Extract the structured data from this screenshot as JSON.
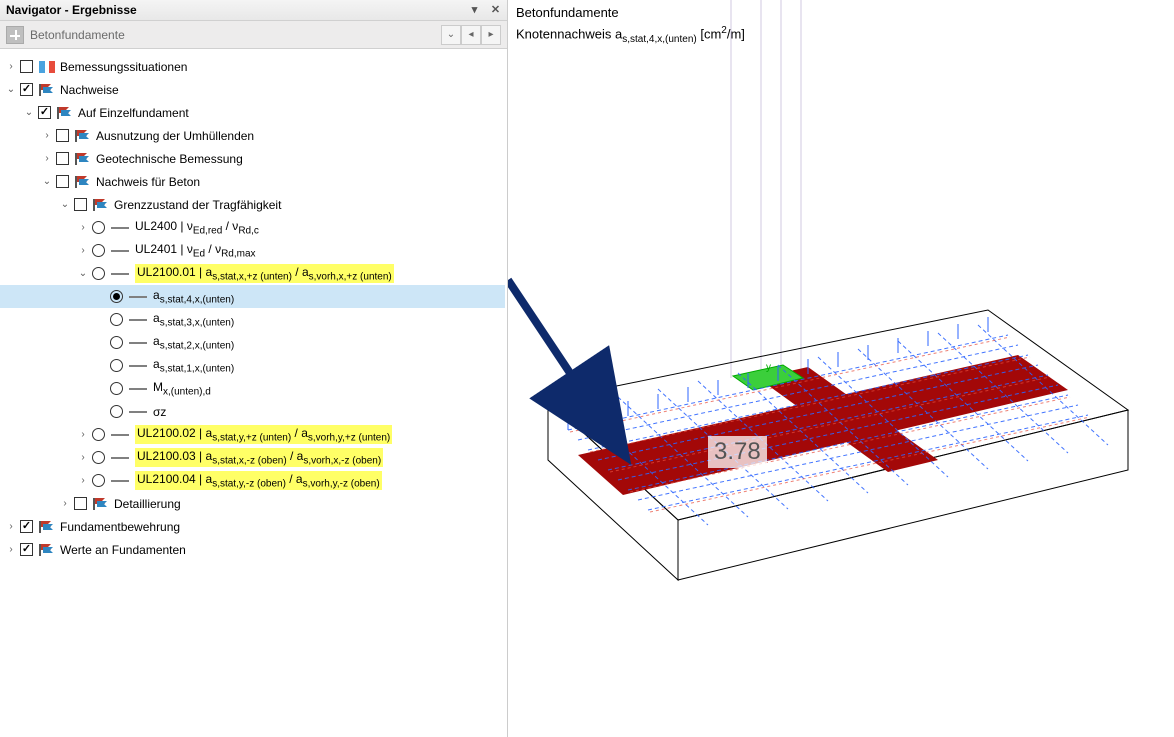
{
  "panel": {
    "title": "Navigator - Ergebnisse",
    "toolbar_label": "Betonfundamente"
  },
  "tree": {
    "r0": "Bemessungssituationen",
    "r1": "Nachweise",
    "r2": "Auf Einzelfundament",
    "r3": "Ausnutzung der Umhüllenden",
    "r4": "Geotechnische Bemessung",
    "r5": "Nachweis für Beton",
    "r6": "Grenzzustand der Tragfähigkeit",
    "r7_a": "UL2400 | ν",
    "r7_b": "Ed,red",
    "r7_c": " / ν",
    "r7_d": "Rd,c",
    "r8_a": "UL2401 | ν",
    "r8_b": "Ed",
    "r8_c": " / ν",
    "r8_d": "Rd,max",
    "r9_a": "UL2100.01 | a",
    "r9_b": "s,stat,x,+z (unten)",
    "r9_c": " / a",
    "r9_d": "s,vorh,x,+z (unten)",
    "r10_a": "a",
    "r10_b": "s,stat,4,x,(unten)",
    "r11_a": "a",
    "r11_b": "s,stat,3,x,(unten)",
    "r12_a": "a",
    "r12_b": "s,stat,2,x,(unten)",
    "r13_a": "a",
    "r13_b": "s,stat,1,x,(unten)",
    "r14_a": "M",
    "r14_b": "x,(unten),d",
    "r15": "σz",
    "r16_a": "UL2100.02 | a",
    "r16_b": "s,stat,y,+z (unten)",
    "r16_c": " / a",
    "r16_d": "s,vorh,y,+z (unten)",
    "r17_a": "UL2100.03 | a",
    "r17_b": "s,stat,x,-z (oben)",
    "r17_c": " / a",
    "r17_d": "s,vorh,x,-z (oben)",
    "r18_a": "UL2100.04 | a",
    "r18_b": "s,stat,y,-z (oben)",
    "r18_c": " / a",
    "r18_d": "s,vorh,y,-z (oben)",
    "r19": "Detaillierung",
    "r20": "Fundamentbewehrung",
    "r21": "Werte an Fundamenten"
  },
  "viewport": {
    "line1": "Betonfundamente",
    "line2_a": "Knotennachweis a",
    "line2_b": "s,stat,4,x,(unten)",
    "line2_c": " [cm",
    "line2_d": "2",
    "line2_e": "/m]",
    "value": "3.78"
  }
}
